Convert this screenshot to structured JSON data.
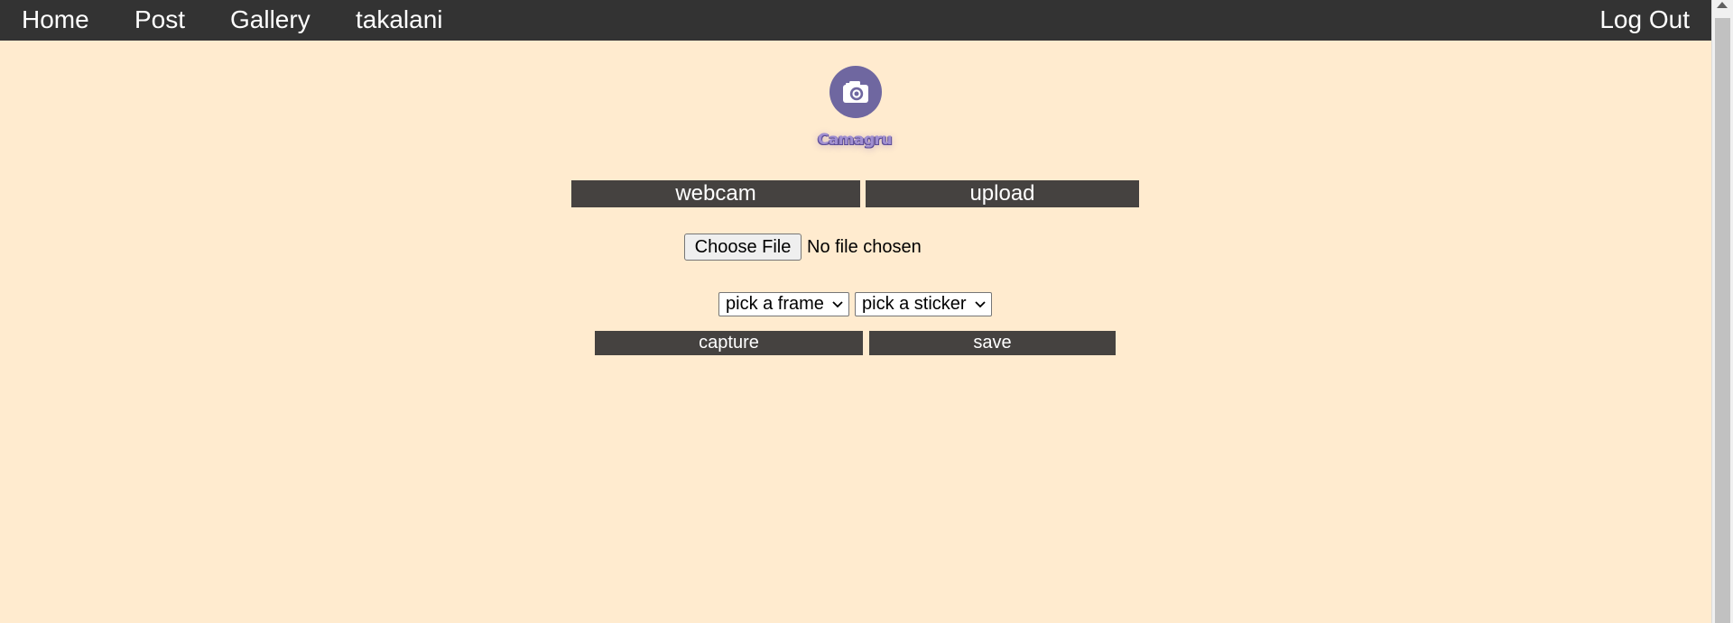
{
  "nav": {
    "links": [
      "Home",
      "Post",
      "Gallery",
      "takalani"
    ],
    "logout": "Log Out",
    "background": "#333333",
    "text_color": "#ffffff"
  },
  "logo": {
    "icon": "camera-icon",
    "title": "Camagru",
    "icon_color": "#6f67a0",
    "title_color": "#a08fd0"
  },
  "source_buttons": {
    "webcam": "webcam",
    "upload": "upload"
  },
  "file_input": {
    "button_label": "Choose File",
    "status": "No file chosen"
  },
  "selects": {
    "frame": "pick a frame",
    "sticker": "pick a sticker"
  },
  "actions": {
    "capture": "capture",
    "save": "save"
  },
  "colors": {
    "page_background": "#ffebcf",
    "button_background": "#454240"
  }
}
